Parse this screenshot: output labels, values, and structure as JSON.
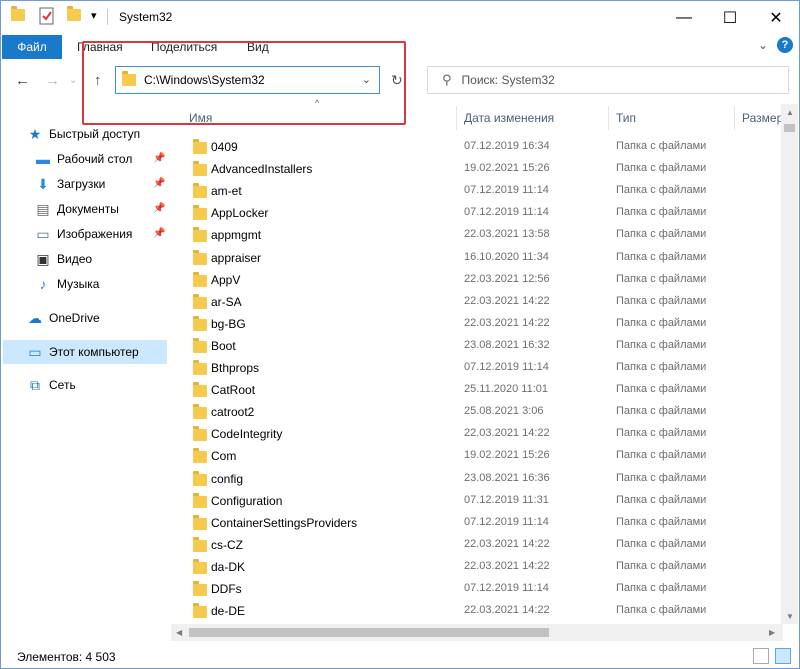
{
  "window": {
    "title": "System32",
    "minimize": "—",
    "maximize": "☐",
    "close": "✕"
  },
  "ribbon": {
    "file": "Файл",
    "tabs": [
      "Главная",
      "Поделиться",
      "Вид"
    ],
    "collapse": "⌄",
    "help": "?"
  },
  "nav": {
    "back": "←",
    "forward": "→",
    "recent": "⌄",
    "up": "↑",
    "address": "C:\\Windows\\System32",
    "address_dropdown": "⌄",
    "refresh": "↻",
    "search_placeholder": "Поиск: System32",
    "sort_caret": "^"
  },
  "sidebar": {
    "items": [
      {
        "label": "Быстрый доступ",
        "icon": "star-icon",
        "glyph": "★"
      },
      {
        "label": "Рабочий стол",
        "icon": "desktop-icon",
        "glyph": "▬",
        "pin": "📌"
      },
      {
        "label": "Загрузки",
        "icon": "downloads-icon",
        "glyph": "⬇",
        "pin": "📌"
      },
      {
        "label": "Документы",
        "icon": "documents-icon",
        "glyph": "▤",
        "pin": "📌"
      },
      {
        "label": "Изображения",
        "icon": "pictures-icon",
        "glyph": "▭",
        "pin": "📌"
      },
      {
        "label": "Видео",
        "icon": "video-icon",
        "glyph": "▣"
      },
      {
        "label": "Музыка",
        "icon": "music-icon",
        "glyph": "♪"
      },
      {
        "label": "OneDrive",
        "icon": "onedrive-icon",
        "glyph": "☁"
      },
      {
        "label": "Этот компьютер",
        "icon": "computer-icon",
        "glyph": "▭"
      },
      {
        "label": "Сеть",
        "icon": "network-icon",
        "glyph": "⧉"
      }
    ]
  },
  "columns": {
    "name": "Имя",
    "date": "Дата изменения",
    "type": "Тип",
    "size": "Размер"
  },
  "files": [
    {
      "name": "0409",
      "date": "07.12.2019 16:34",
      "type": "Папка с файлами"
    },
    {
      "name": "AdvancedInstallers",
      "date": "19.02.2021 15:26",
      "type": "Папка с файлами"
    },
    {
      "name": "am-et",
      "date": "07.12.2019 11:14",
      "type": "Папка с файлами"
    },
    {
      "name": "AppLocker",
      "date": "07.12.2019 11:14",
      "type": "Папка с файлами"
    },
    {
      "name": "appmgmt",
      "date": "22.03.2021 13:58",
      "type": "Папка с файлами"
    },
    {
      "name": "appraiser",
      "date": "16.10.2020 11:34",
      "type": "Папка с файлами"
    },
    {
      "name": "AppV",
      "date": "22.03.2021 12:56",
      "type": "Папка с файлами"
    },
    {
      "name": "ar-SA",
      "date": "22.03.2021 14:22",
      "type": "Папка с файлами"
    },
    {
      "name": "bg-BG",
      "date": "22.03.2021 14:22",
      "type": "Папка с файлами"
    },
    {
      "name": "Boot",
      "date": "23.08.2021 16:32",
      "type": "Папка с файлами"
    },
    {
      "name": "Bthprops",
      "date": "07.12.2019 11:14",
      "type": "Папка с файлами"
    },
    {
      "name": "CatRoot",
      "date": "25.11.2020 11:01",
      "type": "Папка с файлами"
    },
    {
      "name": "catroot2",
      "date": "25.08.2021 3:06",
      "type": "Папка с файлами"
    },
    {
      "name": "CodeIntegrity",
      "date": "22.03.2021 14:22",
      "type": "Папка с файлами"
    },
    {
      "name": "Com",
      "date": "19.02.2021 15:26",
      "type": "Папка с файлами"
    },
    {
      "name": "config",
      "date": "23.08.2021 16:36",
      "type": "Папка с файлами"
    },
    {
      "name": "Configuration",
      "date": "07.12.2019 11:31",
      "type": "Папка с файлами"
    },
    {
      "name": "ContainerSettingsProviders",
      "date": "07.12.2019 11:14",
      "type": "Папка с файлами"
    },
    {
      "name": "cs-CZ",
      "date": "22.03.2021 14:22",
      "type": "Папка с файлами"
    },
    {
      "name": "da-DK",
      "date": "22.03.2021 14:22",
      "type": "Папка с файлами"
    },
    {
      "name": "DDFs",
      "date": "07.12.2019 11:14",
      "type": "Папка с файлами"
    },
    {
      "name": "de-DE",
      "date": "22.03.2021 14:22",
      "type": "Папка с файлами"
    }
  ],
  "status": {
    "count": "Элементов: 4 503"
  },
  "colors": {
    "accent": "#1979ca",
    "highlight": "#d8383f",
    "folder": "#f6c94f"
  }
}
